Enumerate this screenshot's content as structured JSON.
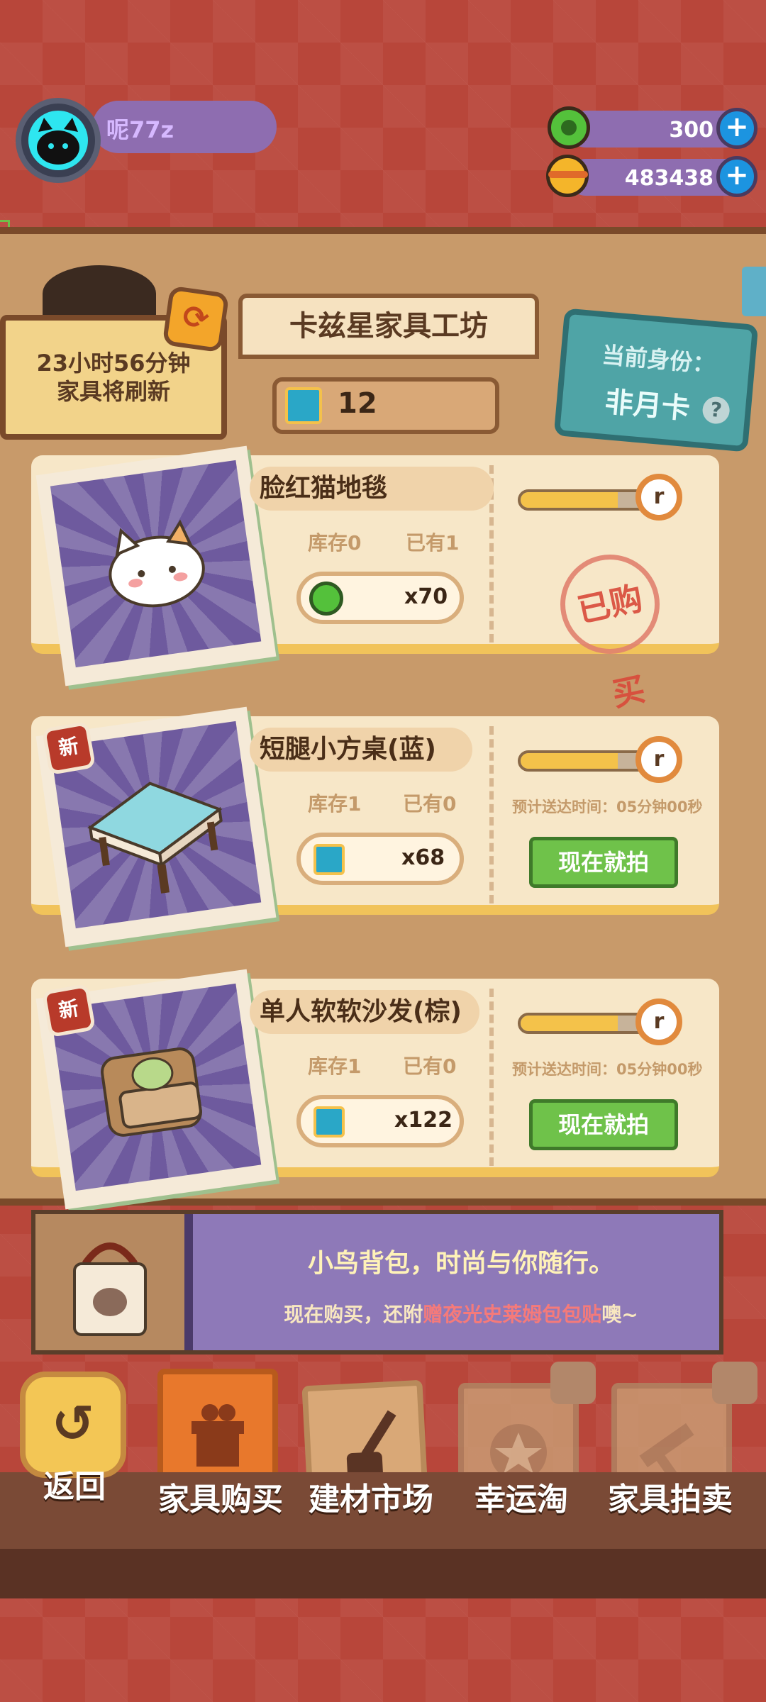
{
  "player": {
    "name": "呢77z"
  },
  "currencies": {
    "green": "300",
    "gold": "483438",
    "plus": "+"
  },
  "shop": {
    "title": "卡兹星家具工坊",
    "tickets": "12",
    "refresh_line1": "23小时56分钟",
    "refresh_line2": "家具将刷新",
    "identity_label": "当前身份：",
    "identity_value": "非月卡",
    "help": "?"
  },
  "items": [
    {
      "name": "脸红猫地毯",
      "stock": "库存0",
      "owned": "已有1",
      "price": "x70",
      "currency": "green-coin",
      "status": "已购买",
      "progress": 0.75,
      "new": false
    },
    {
      "name": "短腿小方桌(蓝)",
      "stock": "库存1",
      "owned": "已有0",
      "price": "x68",
      "currency": "ticket",
      "eta": "预计送达时间：05分钟00秒",
      "button": "现在就拍",
      "progress": 0.75,
      "new": true
    },
    {
      "name": "单人软软沙发(棕)",
      "stock": "库存1",
      "owned": "已有0",
      "price": "x122",
      "currency": "ticket",
      "eta": "预计送达时间：05分钟00秒",
      "button": "现在就拍",
      "progress": 0.75,
      "new": true
    }
  ],
  "new_badge": "新",
  "clock_symbol": "r",
  "banner": {
    "title": "小鸟背包，时尚与你随行。",
    "sub_prefix": "现在购买，还附",
    "sub_highlight": "赠夜光史莱姆包包贴",
    "sub_suffix": "噢~"
  },
  "nav": {
    "back": "返回",
    "tabs": [
      {
        "label": "家具购买",
        "active": true,
        "locked": false
      },
      {
        "label": "建材市场",
        "active": false,
        "locked": false
      },
      {
        "label": "幸运淘",
        "active": false,
        "locked": true
      },
      {
        "label": "家具拍卖",
        "active": false,
        "locked": true
      }
    ]
  },
  "colors": {
    "accent_orange": "#e8782c",
    "purple": "#8e6db0",
    "board": "#c89a6a"
  }
}
